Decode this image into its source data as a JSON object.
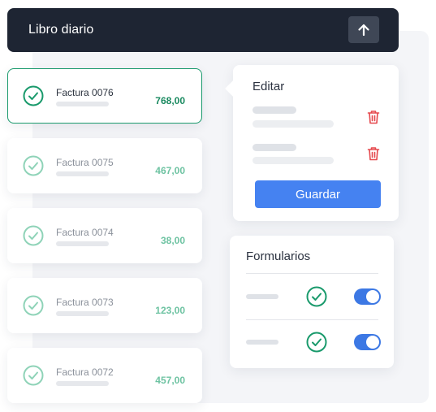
{
  "header": {
    "title": "Libro diario",
    "upload_icon": "arrow-up-icon"
  },
  "invoices": [
    {
      "name": "Factura 0076",
      "amount": "768,00",
      "active": true
    },
    {
      "name": "Factura 0075",
      "amount": "467,00",
      "active": false
    },
    {
      "name": "Factura 0074",
      "amount": "38,00",
      "active": false
    },
    {
      "name": "Factura 0073",
      "amount": "123,00",
      "active": false
    },
    {
      "name": "Factura 0072",
      "amount": "457,00",
      "active": false
    }
  ],
  "edit_panel": {
    "title": "Editar",
    "save_label": "Guardar",
    "delete_icon": "trash-icon"
  },
  "forms_panel": {
    "title": "Formularios",
    "rows": [
      {
        "checked": true,
        "toggle_on": true
      },
      {
        "checked": true,
        "toggle_on": true
      }
    ]
  },
  "colors": {
    "header_bg": "#1e2533",
    "accent_green": "#1a9a6c",
    "primary_blue": "#4582f1",
    "danger_red": "#e5484d"
  }
}
